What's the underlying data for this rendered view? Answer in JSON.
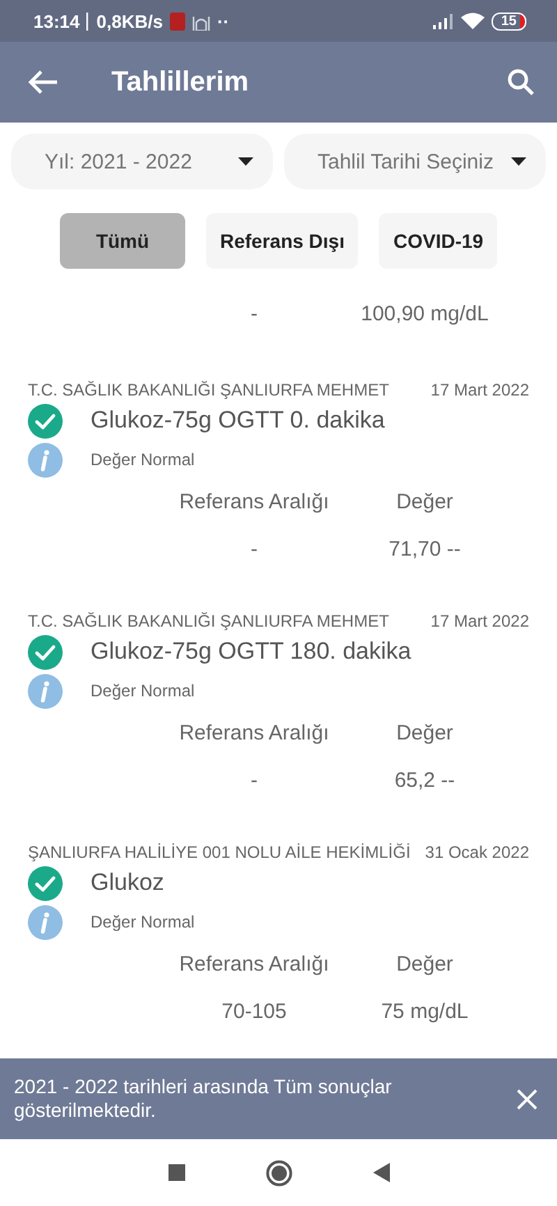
{
  "status_bar": {
    "time": "13:14",
    "speed": "0,8KB/s",
    "dots": "··",
    "battery": "15"
  },
  "app_bar": {
    "title": "Tahlillerim"
  },
  "filters": [
    {
      "label": "Yıl: 2021 - 2022"
    },
    {
      "label": "Tahlil Tarihi Seçiniz"
    }
  ],
  "chips": [
    {
      "label": "Tümü",
      "selected": true
    },
    {
      "label": "Referans Dışı",
      "selected": false
    },
    {
      "label": "COVID-19",
      "selected": false
    }
  ],
  "partial_result": {
    "range": "-",
    "value": "100,90 mg/dL"
  },
  "results": [
    {
      "institution": "T.C. SAĞLIK BAKANLIĞI ŞANLIURFA MEHMET",
      "date": "17 Mart 2022",
      "test": "Glukoz-75g OGTT 0. dakika",
      "status": "Değer Normal",
      "normal": true,
      "range_label": "Referans Aralığı",
      "value_label": "Değer",
      "range": "-",
      "value": "71,70 --"
    },
    {
      "institution": "T.C. SAĞLIK BAKANLIĞI ŞANLIURFA MEHMET",
      "date": "17 Mart 2022",
      "test": "Glukoz-75g OGTT 180. dakika",
      "status": "Değer Normal",
      "normal": true,
      "range_label": "Referans Aralığı",
      "value_label": "Değer",
      "range": "-",
      "value": "65,2 --"
    },
    {
      "institution": "ŞANLIURFA HALİLİYE 001 NOLU AİLE HEKİMLİĞİ",
      "date": "31 Ocak 2022",
      "test": "Glukoz",
      "status": "Değer Normal",
      "normal": true,
      "range_label": "Referans Aralığı",
      "value_label": "Değer",
      "range": "70-105",
      "value": "75 mg/dL"
    }
  ],
  "toast": {
    "message": "2021 - 2022 tarihleri arasında Tüm sonuçlar gösterilmektedir."
  }
}
